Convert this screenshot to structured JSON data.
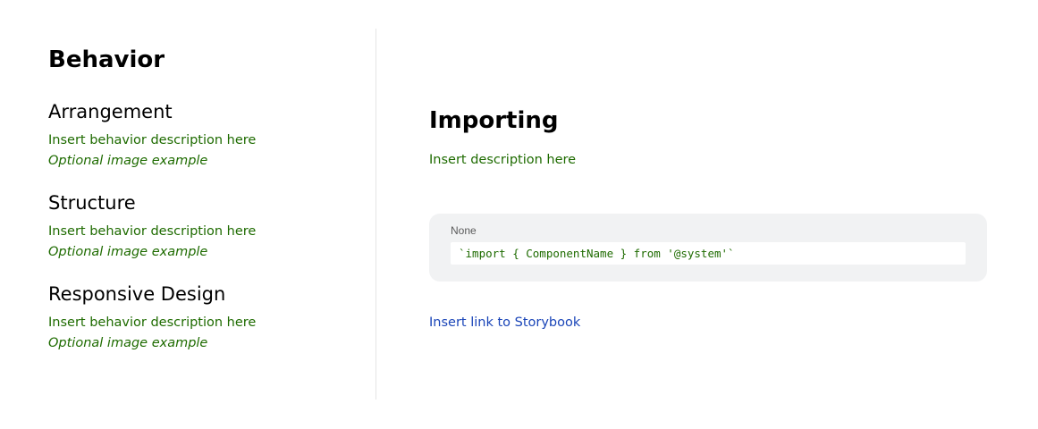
{
  "behavior": {
    "title": "Behavior",
    "sections": [
      {
        "heading": "Arrangement",
        "description": "Insert behavior description here",
        "image_note": "Optional image example"
      },
      {
        "heading": "Structure",
        "description": "Insert behavior description here",
        "image_note": "Optional image example"
      },
      {
        "heading": "Responsive Design",
        "description": "Insert behavior description here",
        "image_note": "Optional image example"
      }
    ]
  },
  "importing": {
    "title": "Importing",
    "description": "Insert description here",
    "code_block": {
      "language": "None",
      "code": "`import { ComponentName } from '@system'`"
    },
    "storybook_link": "Insert link to Storybook"
  },
  "colors": {
    "placeholder_text": "#1e6b00",
    "link": "#1a45b8",
    "code_card_bg": "#f1f2f3",
    "divider": "#e4e4e4"
  }
}
